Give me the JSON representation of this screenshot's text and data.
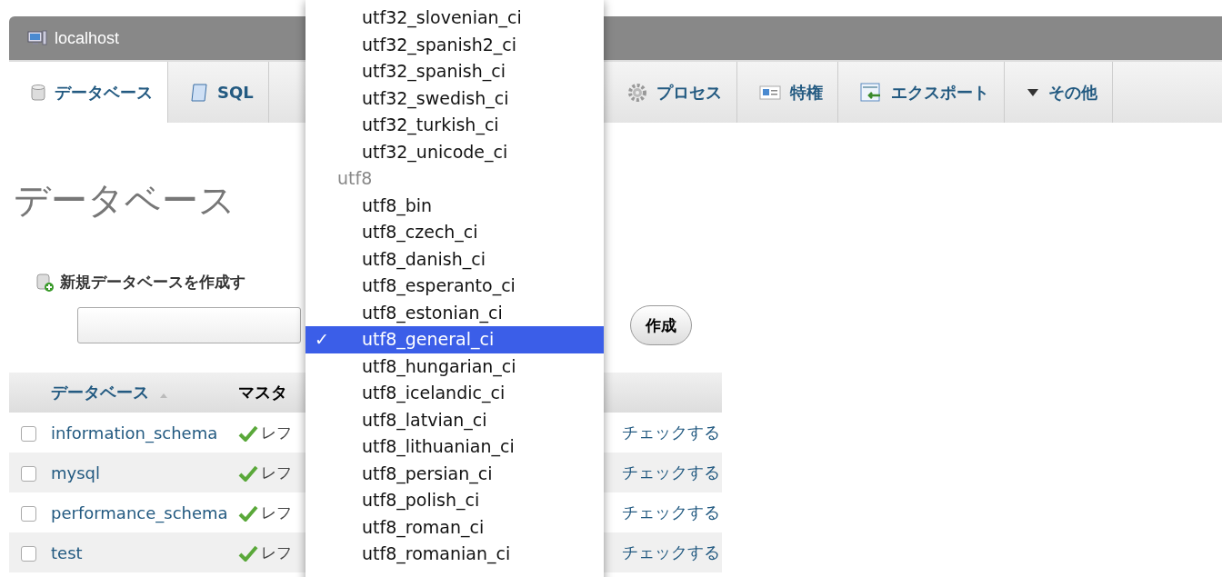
{
  "server": {
    "title": "localhost"
  },
  "tabs": [
    {
      "label": "データベース",
      "selected": true
    },
    {
      "label": "SQL",
      "selected": false
    },
    {
      "label": "プロセス",
      "selected": false
    },
    {
      "label": "特権",
      "selected": false
    },
    {
      "label": "エクスポート",
      "selected": false
    },
    {
      "label": "その他",
      "selected": false
    }
  ],
  "page_title": "データベース",
  "create": {
    "label": "新規データベースを作成す",
    "button": "作成"
  },
  "table": {
    "columns": [
      "データベース",
      "マスタ"
    ],
    "rows": [
      {
        "checked": false,
        "name": "information_schema",
        "column_2": "レフ",
        "action": "チェックする"
      },
      {
        "checked": false,
        "name": "mysql",
        "column_2": "レフ",
        "action": "チェックする"
      },
      {
        "checked": false,
        "name": "performance_schema",
        "column_2": "レフ",
        "action": "チェックする"
      },
      {
        "checked": false,
        "name": "test",
        "column_2": "レフ",
        "action": "チェックする"
      }
    ]
  },
  "collation_menu": {
    "items": [
      {
        "kind": "option",
        "label": "utf32_slovenian_ci",
        "selected": false
      },
      {
        "kind": "option",
        "label": "utf32_spanish2_ci",
        "selected": false
      },
      {
        "kind": "option",
        "label": "utf32_spanish_ci",
        "selected": false
      },
      {
        "kind": "option",
        "label": "utf32_swedish_ci",
        "selected": false
      },
      {
        "kind": "option",
        "label": "utf32_turkish_ci",
        "selected": false
      },
      {
        "kind": "option",
        "label": "utf32_unicode_ci",
        "selected": false
      },
      {
        "kind": "group",
        "label": "utf8"
      },
      {
        "kind": "option",
        "label": "utf8_bin",
        "selected": false
      },
      {
        "kind": "option",
        "label": "utf8_czech_ci",
        "selected": false
      },
      {
        "kind": "option",
        "label": "utf8_danish_ci",
        "selected": false
      },
      {
        "kind": "option",
        "label": "utf8_esperanto_ci",
        "selected": false
      },
      {
        "kind": "option",
        "label": "utf8_estonian_ci",
        "selected": false
      },
      {
        "kind": "option",
        "label": "utf8_general_ci",
        "selected": true,
        "check": "✓"
      },
      {
        "kind": "option",
        "label": "utf8_hungarian_ci",
        "selected": false
      },
      {
        "kind": "option",
        "label": "utf8_icelandic_ci",
        "selected": false
      },
      {
        "kind": "option",
        "label": "utf8_latvian_ci",
        "selected": false
      },
      {
        "kind": "option",
        "label": "utf8_lithuanian_ci",
        "selected": false
      },
      {
        "kind": "option",
        "label": "utf8_persian_ci",
        "selected": false
      },
      {
        "kind": "option",
        "label": "utf8_polish_ci",
        "selected": false
      },
      {
        "kind": "option",
        "label": "utf8_roman_ci",
        "selected": false
      },
      {
        "kind": "option",
        "label": "utf8_romanian_ci",
        "selected": false
      }
    ]
  }
}
